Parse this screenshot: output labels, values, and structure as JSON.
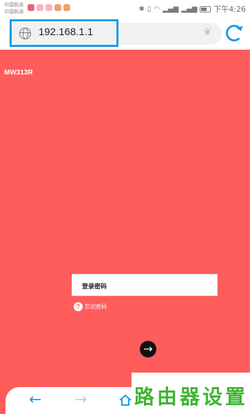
{
  "status_bar": {
    "carrier_1": "中国联通",
    "carrier_2": "中国联通",
    "time": "下午4:26",
    "icons": [
      "heartbeat-icon",
      "bluetooth-icon",
      "vibrate-icon",
      "wifi-icon",
      "signal-4g-icon",
      "signal-2g-icon",
      "battery-icon"
    ]
  },
  "browser": {
    "url": "192.168.1.1",
    "highlight_color": "#1a9be6"
  },
  "page": {
    "background_color": "#ff5c5c",
    "device_model": "MW313R",
    "password_placeholder": "登录密码",
    "forgot_password": "忘记密码",
    "help_icon_glyph": "?",
    "login_button_glyph": "→"
  },
  "bottom_nav": {
    "back_glyph": "←",
    "forward_glyph": "→"
  },
  "watermark": {
    "text": "路由器设置",
    "color": "#3fb531"
  }
}
